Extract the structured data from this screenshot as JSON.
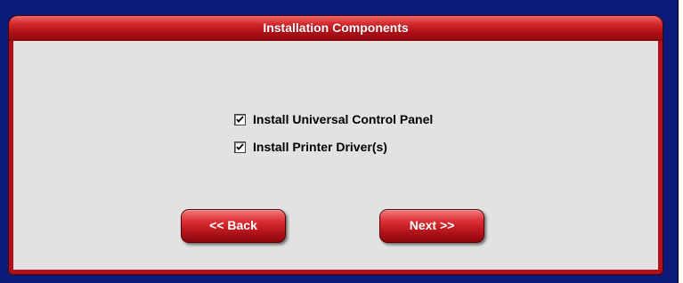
{
  "dialog": {
    "title": "Installation Components"
  },
  "options": [
    {
      "label": "Install Universal Control Panel",
      "checked": true
    },
    {
      "label": "Install Printer Driver(s)",
      "checked": true
    }
  ],
  "buttons": {
    "back_label": "<< Back",
    "next_label": "Next >>"
  },
  "colors": {
    "frame": "#0c1a78",
    "panel_red": "#b0101a",
    "content_gray": "#e2e2e2"
  }
}
